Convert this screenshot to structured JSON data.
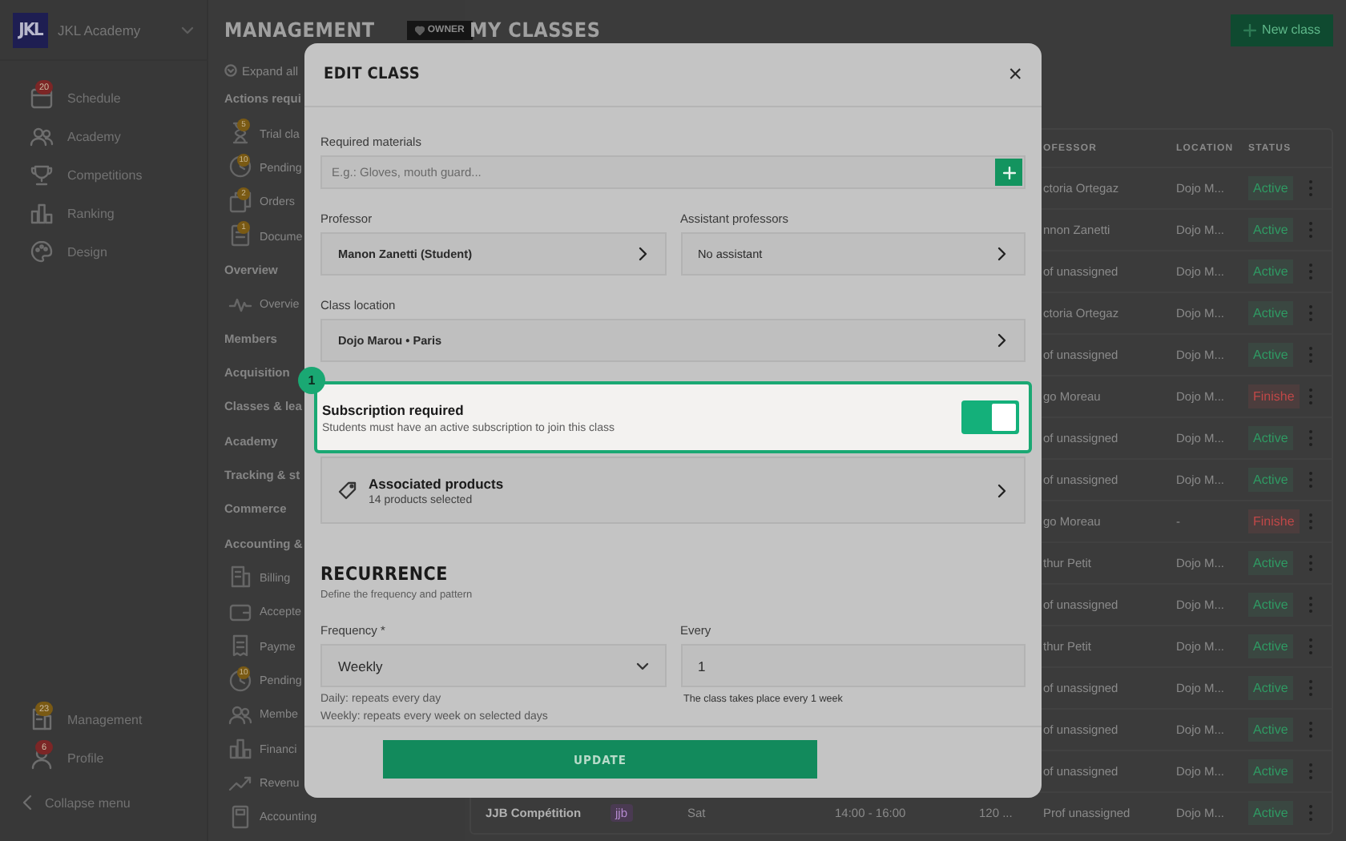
{
  "sidebar": {
    "logo": "JKL",
    "org_name": "JKL Academy",
    "items": [
      {
        "label": "Schedule",
        "selected": false,
        "badge": {
          "text": "20",
          "color": "#7c2626"
        }
      },
      {
        "label": "Academy",
        "selected": false
      },
      {
        "label": "Competitions",
        "selected": false
      },
      {
        "label": "Ranking",
        "selected": false
      },
      {
        "label": "Design",
        "selected": false
      }
    ],
    "bottom_items": [
      {
        "label": "Management",
        "selected": false,
        "badge": {
          "text": "23",
          "color": "#7a5a14"
        }
      },
      {
        "label": "Profile",
        "selected": false,
        "badge": {
          "text": "6",
          "color": "#7c2626"
        }
      }
    ],
    "collapse": "Collapse menu"
  },
  "management": {
    "title": "MANAGEMENT",
    "role": "OWNER",
    "expand_all": "Expand all",
    "groups": [
      {
        "label": "Actions requi",
        "children": [
          {
            "label": "Trial cla",
            "badge": "5"
          },
          {
            "label": "Pending",
            "badge": "10"
          },
          {
            "label": "Orders",
            "badge": "2"
          },
          {
            "label": "Docume",
            "badge": "1"
          }
        ]
      },
      {
        "label": "Overview",
        "children": [
          {
            "label": "Overvie"
          }
        ]
      },
      {
        "label": "Members"
      },
      {
        "label": "Acquisition"
      },
      {
        "label": "Classes & lea"
      },
      {
        "label": "Academy"
      },
      {
        "label": "Tracking & st"
      },
      {
        "label": "Commerce"
      },
      {
        "label": "Accounting &",
        "children": [
          {
            "label": "Billing"
          },
          {
            "label": "Accepte"
          },
          {
            "label": "Payme"
          },
          {
            "label": "Pending",
            "badge": "10"
          },
          {
            "label": "Membe"
          },
          {
            "label": "Financi"
          },
          {
            "label": "Revenu"
          },
          {
            "label": "Accounting"
          }
        ]
      }
    ]
  },
  "classes": {
    "title": "MY CLASSES",
    "new_button": "New class",
    "columns": [
      "OFESSOR",
      "LOCATION",
      "STATUS"
    ],
    "rows": [
      {
        "professor": "ctoria Ortegaz",
        "location": "Dojo M...",
        "status": {
          "text": "Active",
          "color": "#2f9a63"
        }
      },
      {
        "professor": "nnon Zanetti",
        "location": "Dojo M...",
        "status": {
          "text": "Active",
          "color": "#2f9a63"
        }
      },
      {
        "professor": "of unassigned",
        "location": "Dojo M...",
        "status": {
          "text": "Active",
          "color": "#2f9a63"
        }
      },
      {
        "professor": "ctoria Ortegaz",
        "location": "Dojo M...",
        "status": {
          "text": "Active",
          "color": "#2f9a63"
        }
      },
      {
        "professor": "of unassigned",
        "location": "Dojo M...",
        "status": {
          "text": "Active",
          "color": "#2f9a63"
        }
      },
      {
        "professor": "go Moreau",
        "location": "Dojo M...",
        "status": {
          "text": "Finishe",
          "color": "#c04848"
        }
      },
      {
        "professor": "of unassigned",
        "location": "Dojo M...",
        "status": {
          "text": "Active",
          "color": "#2f9a63"
        }
      },
      {
        "professor": "of unassigned",
        "location": "Dojo M...",
        "status": {
          "text": "Active",
          "color": "#2f9a63"
        }
      },
      {
        "professor": "go Moreau",
        "location": "-",
        "status": {
          "text": "Finishe",
          "color": "#c04848"
        }
      },
      {
        "professor": "thur Petit",
        "location": "Dojo M...",
        "status": {
          "text": "Active",
          "color": "#2f9a63"
        }
      },
      {
        "professor": "of unassigned",
        "location": "Dojo M...",
        "status": {
          "text": "Active",
          "color": "#2f9a63"
        }
      },
      {
        "professor": "thur Petit",
        "location": "Dojo M...",
        "status": {
          "text": "Active",
          "color": "#2f9a63"
        }
      },
      {
        "professor": "of unassigned",
        "location": "Dojo M...",
        "status": {
          "text": "Active",
          "color": "#2f9a63"
        }
      },
      {
        "professor": "of unassigned",
        "location": "Dojo M...",
        "status": {
          "text": "Active",
          "color": "#2f9a63"
        }
      },
      {
        "professor": "of unassigned",
        "location": "Dojo M...",
        "status": {
          "text": "Active",
          "color": "#2f9a63"
        }
      },
      {
        "name": "JJB Compétition",
        "tag": "jjb",
        "day": "Sat",
        "time": "14:00 - 16:00",
        "capacity": "120 ...",
        "professor": "Prof unassigned",
        "location": "Dojo M...",
        "status": {
          "text": "Active",
          "color": "#2f9a63"
        }
      }
    ]
  },
  "modal": {
    "title": "EDIT CLASS",
    "close": "×",
    "materials": {
      "label": "Required materials",
      "placeholder": "E.g.: Gloves, mouth guard..."
    },
    "professor": {
      "label": "Professor",
      "value": "Manon Zanetti (Student)"
    },
    "assistants": {
      "label": "Assistant professors",
      "value": "No assistant"
    },
    "location": {
      "label": "Class location",
      "value": "Dojo Marou • Paris"
    },
    "subscription": {
      "step": "1",
      "title": "Subscription required",
      "description": "Students must have an active subscription to join this class",
      "on": true
    },
    "products": {
      "title": "Associated products",
      "subtitle": "14 products selected"
    },
    "recurrence": {
      "title": "RECURRENCE",
      "subtitle": "Define the frequency and pattern",
      "frequency": {
        "label": "Frequency *",
        "value": "Weekly",
        "hints": [
          "Daily: repeats every day",
          "Weekly: repeats every week on selected days"
        ]
      },
      "every": {
        "label": "Every",
        "value": "1",
        "hint": "The class takes place every 1 week"
      }
    },
    "submit": "UPDATE"
  }
}
